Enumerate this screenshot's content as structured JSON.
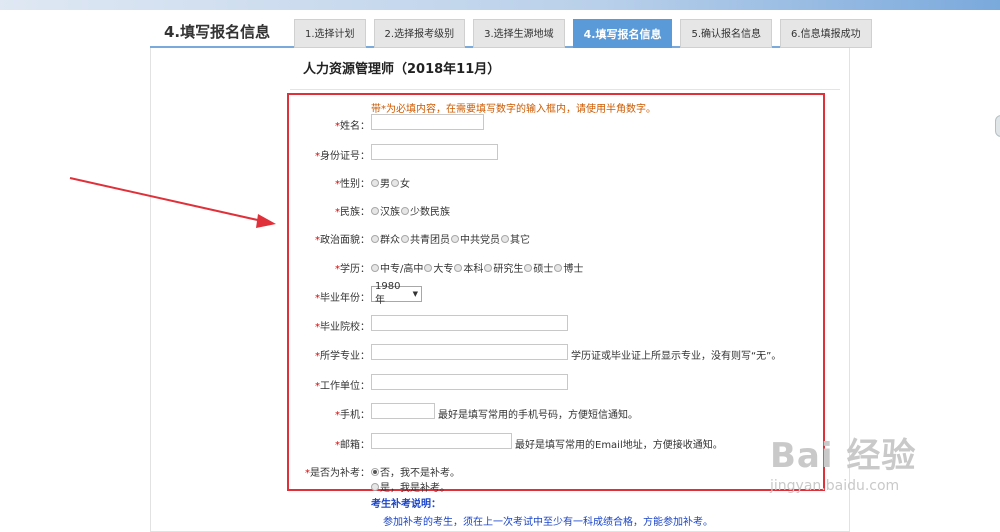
{
  "header": {
    "page_title": "4.填写报名信息",
    "steps": [
      {
        "label": "1.选择计划",
        "active": false
      },
      {
        "label": "2.选择报考级别",
        "active": false
      },
      {
        "label": "3.选择生源地域",
        "active": false
      },
      {
        "label": "4.填写报名信息",
        "active": true
      },
      {
        "label": "5.确认报名信息",
        "active": false
      },
      {
        "label": "6.信息填报成功",
        "active": false
      }
    ],
    "active_color": "#5b9ad8"
  },
  "exam_title": "人力资源管理师（2018年11月）",
  "form": {
    "notice": "带*为必填内容，在需要填写数字的输入框内，请使用半角数字。",
    "required_mark": "*",
    "highlight_color": "#e0303a",
    "fields": {
      "name": {
        "label": "姓名："
      },
      "id_number": {
        "label": "身份证号："
      },
      "gender": {
        "label": "性别：",
        "options": [
          "男",
          "女"
        ]
      },
      "ethnicity": {
        "label": "民族：",
        "options": [
          "汉族",
          "少数民族"
        ]
      },
      "political": {
        "label": "政治面貌：",
        "options": [
          "群众",
          "共青团员",
          "中共党员",
          "其它"
        ]
      },
      "education": {
        "label": "学历：",
        "options": [
          "中专/高中",
          "大专",
          "本科",
          "研究生",
          "硕士",
          "博士"
        ]
      },
      "grad_year": {
        "label": "毕业年份：",
        "value": "1980年"
      },
      "school": {
        "label": "毕业院校："
      },
      "major": {
        "label": "所学专业：",
        "hint": "学历证或毕业证上所显示专业，没有则写“无”。"
      },
      "employer": {
        "label": "工作单位："
      },
      "phone": {
        "label": "手机：",
        "hint": "最好是填写常用的手机号码，方便短信通知。"
      },
      "email": {
        "label": "邮箱：",
        "hint": "最好是填写常用的Email地址，方便接收通知。"
      },
      "retake": {
        "label": "是否为补考：",
        "options": [
          "否，我不是补考。",
          "是，我是补考。"
        ],
        "selected": "否，我不是补考。"
      }
    }
  },
  "retake_note": {
    "title": "考生补考说明：",
    "text": "参加补考的考生，须在上一次考试中至少有一科成绩合格，方能参加补考。"
  },
  "watermark": {
    "main": "Bai 经验",
    "sub": "jingyan.baidu.com"
  }
}
